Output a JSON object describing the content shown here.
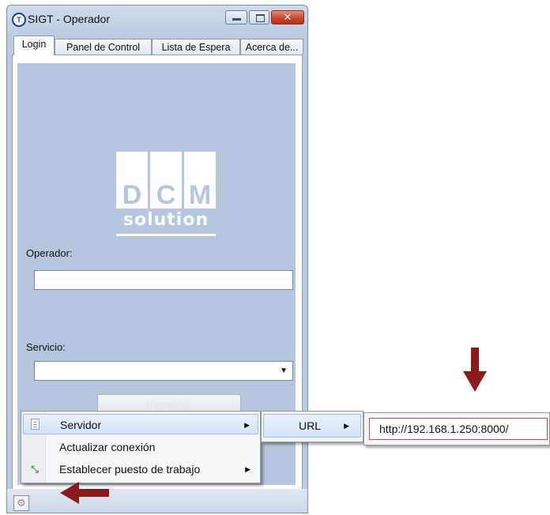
{
  "window": {
    "title": "SIGT - Operador",
    "app_icon_glyph": "T",
    "close_glyph": "✕"
  },
  "tabs": [
    {
      "label": "Login",
      "active": true
    },
    {
      "label": "Panel de Control",
      "active": false
    },
    {
      "label": "Lista de Espera",
      "active": false
    },
    {
      "label": "Acerca de...",
      "active": false
    }
  ],
  "logo": {
    "letters": [
      "D",
      "C",
      "M"
    ],
    "tagline": "solution"
  },
  "form": {
    "operador_label": "Operador:",
    "operador_value": "",
    "servicio_label": "Servicio:",
    "servicio_value": "",
    "submit_label": "Ingresar"
  },
  "context_menu": {
    "items": [
      {
        "label": "Servidor",
        "icon": "document-icon",
        "has_submenu": true,
        "highlighted": true
      },
      {
        "label": "Actualizar conexión",
        "icon": "",
        "has_submenu": false,
        "highlighted": false
      },
      {
        "label": "Establecer puesto de trabajo",
        "icon": "move-icon",
        "has_submenu": true,
        "highlighted": false
      }
    ],
    "submenu_label": "URL",
    "url_value": "http://192.168.1.250:8000/"
  },
  "colors": {
    "tab_body_bg": "#b6c6de",
    "annotation_arrow": "#8b1a1a",
    "menu_highlight": "#d3e3f5",
    "url_border": "#c0504d"
  }
}
